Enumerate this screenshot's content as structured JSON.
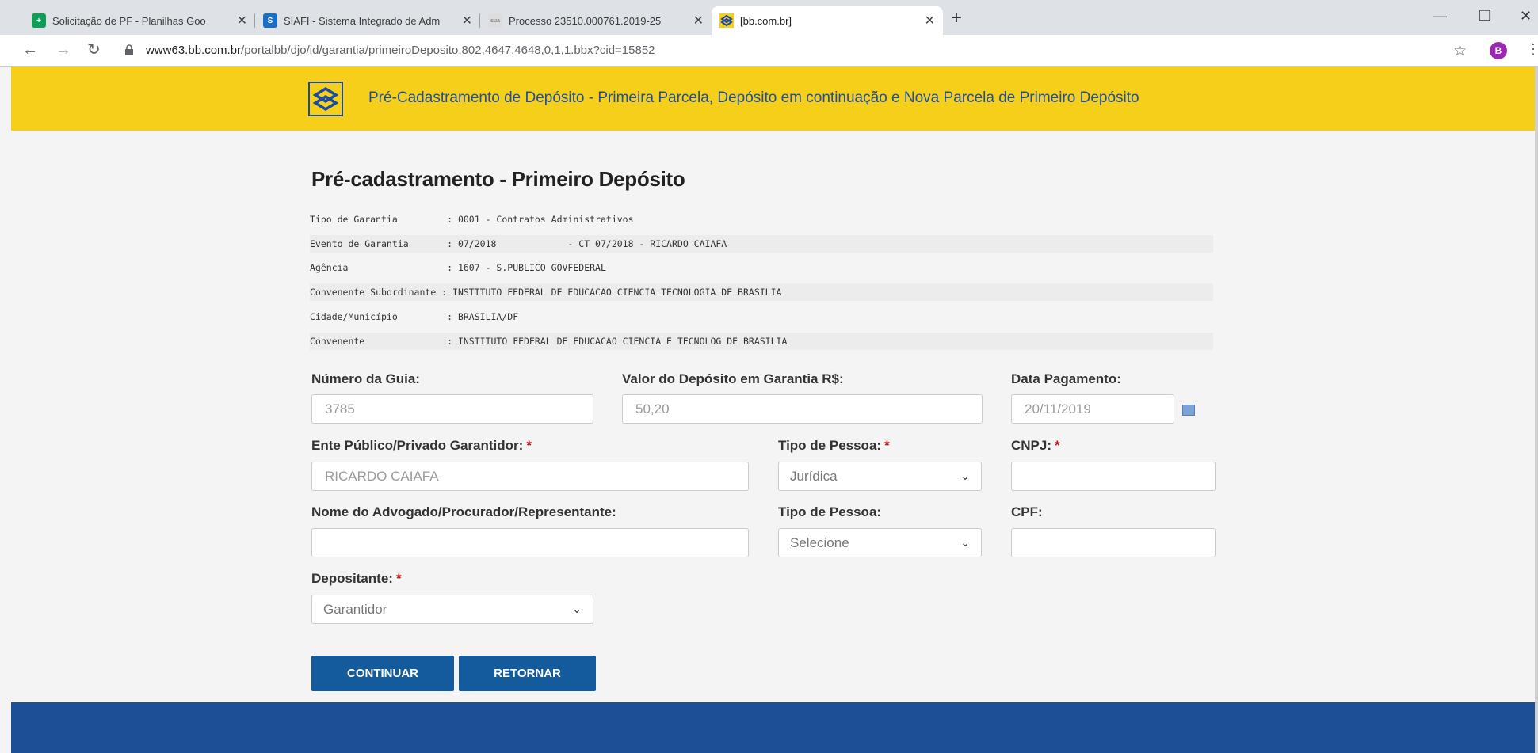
{
  "browser": {
    "tabs": [
      {
        "title": "Solicitação de PF - Planilhas Goo",
        "favicon_color": "#0f9d58",
        "favicon_glyph": "+"
      },
      {
        "title": "SIAFI - Sistema Integrado de Adm",
        "favicon_color": "#1a6fc4",
        "favicon_glyph": "S"
      },
      {
        "title": "Processo 23510.000761.2019-25",
        "favicon_color": "#bbbbbb",
        "favicon_glyph": "sua"
      },
      {
        "title": "[bb.com.br]",
        "favicon_color": "#f5cf1a",
        "favicon_glyph": ""
      }
    ],
    "url_host": "www63.bb.com.br",
    "url_path": "/portalbb/djo/id/garantia/primeiroDeposito,802,4647,4648,0,1,1.bbx?cid=15852",
    "profile_initial": "B"
  },
  "banner": {
    "title": "Pré-Cadastramento de Depósito - Primeira Parcela, Depósito em continuação e Nova Parcela de Primeiro Depósito"
  },
  "page": {
    "heading": "Pré-cadastramento - Primeiro Depósito",
    "info": [
      {
        "label": "Tipo de Garantia       ",
        "value": ": 0001 - Contratos Administrativos"
      },
      {
        "label": "Evento de Garantia     ",
        "value": ": 07/2018             - CT 07/2018 - RICARDO CAIAFA"
      },
      {
        "label": "Agência                ",
        "value": ": 1607 - S.PUBLICO GOVFEDERAL"
      },
      {
        "label": "Convenente Subordinante",
        "value": " : INSTITUTO FEDERAL DE EDUCACAO CIENCIA TECNOLOGIA DE BRASILIA"
      },
      {
        "label": "Cidade/Município       ",
        "value": ": BRASILIA/DF"
      },
      {
        "label": "Convenente             ",
        "value": ": INSTITUTO FEDERAL DE EDUCACAO CIENCIA E TECNOLOG DE BRASILIA"
      }
    ]
  },
  "form": {
    "numero_guia": {
      "label": "Número da Guia:",
      "value": "3785"
    },
    "valor_deposito": {
      "label": "Valor do Depósito em Garantia R$:",
      "value": "50,20"
    },
    "data_pagamento": {
      "label": "Data Pagamento:",
      "value": "20/11/2019"
    },
    "ente_garantidor": {
      "label": "Ente Público/Privado Garantidor:",
      "value": "RICARDO CAIAFA"
    },
    "tipo_pessoa_1": {
      "label": "Tipo de Pessoa:",
      "value": "Jurídica"
    },
    "cnpj": {
      "label": "CNPJ:",
      "value": ""
    },
    "nome_advogado": {
      "label": "Nome do Advogado/Procurador/Representante:",
      "value": ""
    },
    "tipo_pessoa_2": {
      "label": "Tipo de Pessoa:",
      "value": "Selecione"
    },
    "cpf": {
      "label": "CPF:",
      "value": ""
    },
    "depositante": {
      "label": "Depositante:",
      "value": "Garantidor"
    },
    "required_mark": "*"
  },
  "buttons": {
    "continuar": "CONTINUAR",
    "retornar": "RETORNAR"
  },
  "colors": {
    "banner": "#f5cf1a",
    "brand_blue": "#1f4fa3",
    "button": "#135b9c",
    "footer": "#1d4f96",
    "required": "#c0161a"
  }
}
